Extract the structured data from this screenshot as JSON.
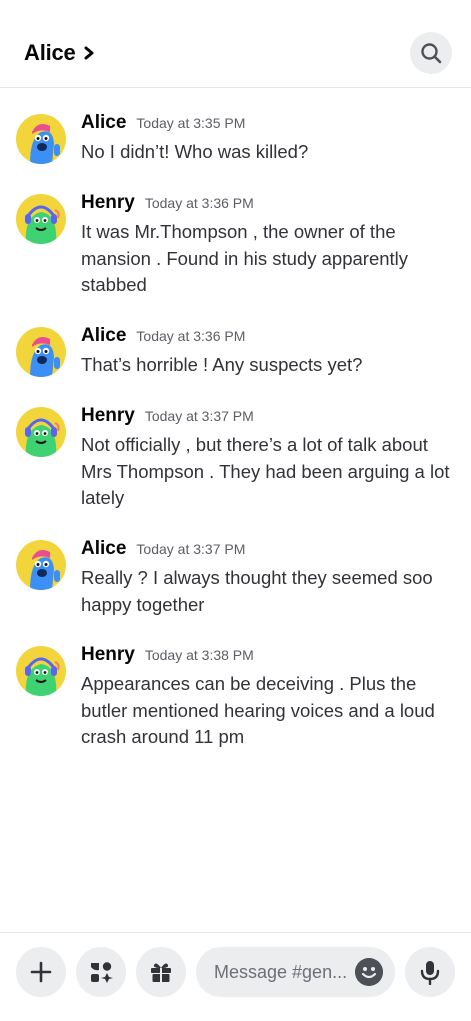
{
  "header": {
    "title": "Alice",
    "chevron_icon": "chevron-right-icon",
    "search_icon": "search-icon"
  },
  "messages": [
    {
      "author": "Alice",
      "time": "Today at 3:35 PM",
      "text": "No I didn’t! Who was killed?",
      "avatar": "blue-avatar"
    },
    {
      "author": "Henry",
      "time": "Today at 3:36 PM",
      "text": "It was Mr.Thompson , the owner of the mansion . Found in his study apparently stabbed",
      "avatar": "green-avatar"
    },
    {
      "author": "Alice",
      "time": "Today at 3:36 PM",
      "text": "That’s horrible ! Any suspects yet?",
      "avatar": "blue-avatar"
    },
    {
      "author": "Henry",
      "time": "Today at 3:37 PM",
      "text": "Not officially , but there’s a lot of talk about Mrs Thompson . They had been arguing a lot lately",
      "avatar": "green-avatar"
    },
    {
      "author": "Alice",
      "time": "Today at 3:37 PM",
      "text": "Really ? I always thought they seemed soo happy together",
      "avatar": "blue-avatar"
    },
    {
      "author": "Henry",
      "time": "Today at 3:38 PM",
      "text": "Appearances can be deceiving . Plus the butler mentioned hearing voices and a loud crash around 11 pm",
      "avatar": "green-avatar"
    }
  ],
  "composer": {
    "placeholder": "Message #gen...",
    "add_icon": "plus-icon",
    "apps_icon": "apps-icon",
    "gift_icon": "gift-icon",
    "emoji_icon": "emoji-icon",
    "mic_icon": "microphone-icon"
  },
  "colors": {
    "avatar_bg": "#f2d43b",
    "alice": "#3b8ff5",
    "henry": "#3fd273"
  }
}
